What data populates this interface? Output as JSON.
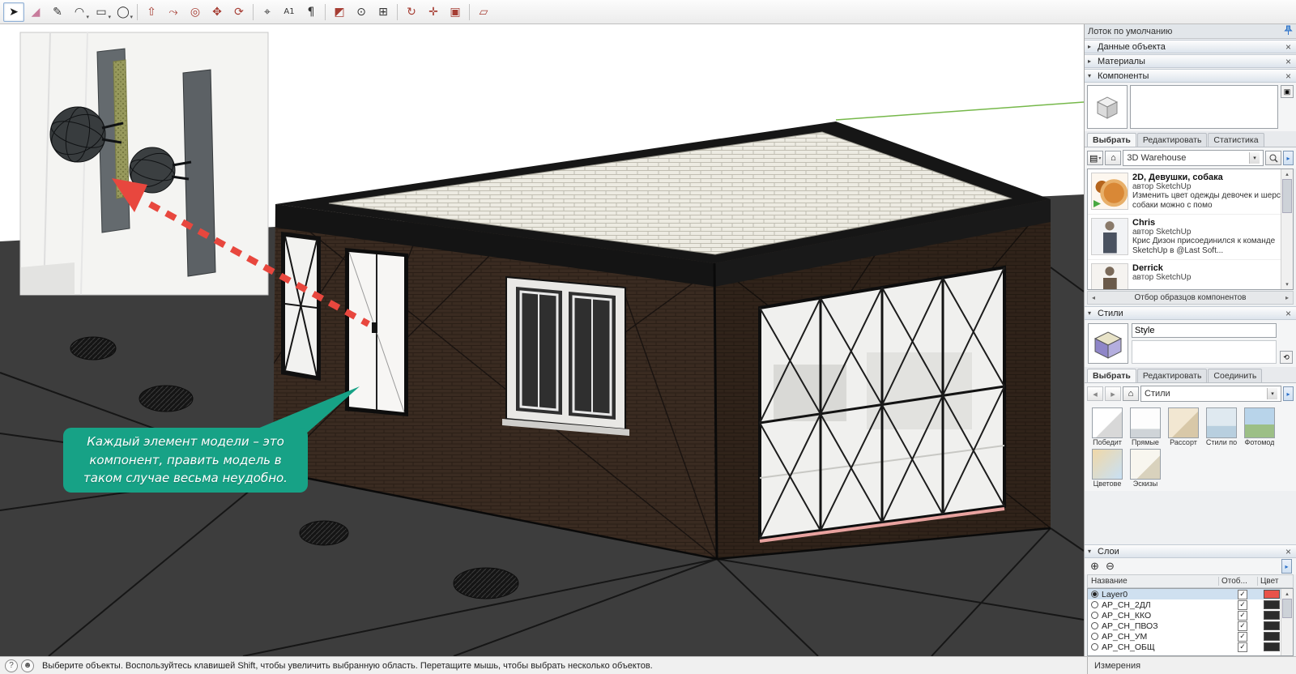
{
  "window": {
    "tray_title": "Лоток по умолчанию"
  },
  "colors": {
    "bubble_teal": "#17a286",
    "arrow_red": "#e8473e",
    "layer0_swatch": "#e8534a",
    "dark_layer_swatch": "#2b2b2b",
    "accent_blue": "#2a6fc9",
    "axis_green": "#76b84a"
  },
  "toolbar": {
    "tools": [
      {
        "name": "select",
        "glyph": "➤",
        "color": "#1a1a1a",
        "active": true
      },
      {
        "name": "eraser",
        "glyph": "◢",
        "color": "#c77b9b"
      },
      {
        "name": "line",
        "glyph": "✎",
        "color": "#333333"
      },
      {
        "name": "arc",
        "glyph": "◠",
        "color": "#333333",
        "dropdown": true
      },
      {
        "name": "rectangle",
        "glyph": "▭",
        "color": "#333333",
        "dropdown": true
      },
      {
        "name": "circle",
        "glyph": "◯",
        "color": "#333333",
        "dropdown": true
      },
      {
        "sep": true
      },
      {
        "name": "push-pull",
        "glyph": "⇧",
        "color": "#a63d33"
      },
      {
        "name": "follow-me",
        "glyph": "⤳",
        "color": "#a63d33"
      },
      {
        "name": "offset",
        "glyph": "◎",
        "color": "#a63d33"
      },
      {
        "name": "move",
        "glyph": "✥",
        "color": "#a63d33"
      },
      {
        "name": "rotate",
        "glyph": "⟳",
        "color": "#a63d33"
      },
      {
        "sep": true
      },
      {
        "name": "tape-measure",
        "glyph": "⌖",
        "color": "#333333"
      },
      {
        "name": "dimension",
        "glyph": "A1",
        "color": "#333333"
      },
      {
        "name": "text",
        "glyph": "¶",
        "color": "#333333"
      },
      {
        "sep": true
      },
      {
        "name": "paint-bucket",
        "glyph": "◩",
        "color": "#a63d33"
      },
      {
        "name": "zoom",
        "glyph": "⊙",
        "color": "#333333"
      },
      {
        "name": "zoom-window",
        "glyph": "⊞",
        "color": "#333333"
      },
      {
        "sep": true
      },
      {
        "name": "orbit",
        "glyph": "↻",
        "color": "#a63d33"
      },
      {
        "name": "pan",
        "glyph": "✛",
        "color": "#a63d33"
      },
      {
        "name": "camera",
        "glyph": "▣",
        "color": "#a63d33"
      },
      {
        "sep": true
      },
      {
        "name": "section-plane",
        "glyph": "▱",
        "color": "#a63d33"
      }
    ]
  },
  "viewport": {
    "bubble": {
      "line1": "Каждый элемент модели – это",
      "line2": "компонент, править модель в",
      "line3": "таком случае весьма неудобно."
    }
  },
  "sidebar": {
    "panels": {
      "entity_info": "Данные объекта",
      "materials": "Материалы",
      "components": "Компоненты",
      "styles": "Стили",
      "layers": "Слои"
    },
    "components": {
      "tabs": [
        "Выбрать",
        "Редактировать",
        "Статистика"
      ],
      "search_value": "3D Warehouse",
      "items": [
        {
          "name": "2D, Девушки, собака",
          "author": "автор SketchUp",
          "desc": "Изменить цвет одежды девочек и шерсти собаки можно с помо",
          "thumb": "dog"
        },
        {
          "name": "Chris",
          "author": "автор SketchUp",
          "desc": "Крис Дизон присоединился к команде SketchUp в @Last Soft...",
          "thumb": "person"
        },
        {
          "name": "Derrick",
          "author": "автор SketchUp",
          "desc": "",
          "thumb": "person2"
        }
      ],
      "footer": "Отбор образцов компонентов"
    },
    "styles": {
      "name_value": "Style",
      "tabs": [
        "Выбрать",
        "Редактировать",
        "Соединить"
      ],
      "collection": "Стили",
      "thumbs": [
        {
          "label": "Победит"
        },
        {
          "label": "Прямые"
        },
        {
          "label": "Рассорт"
        },
        {
          "label": "Стили по"
        },
        {
          "label": "Фотомод"
        },
        {
          "label": "Цветове"
        },
        {
          "label": "Эскизы"
        }
      ]
    },
    "layers": {
      "columns": [
        "Название",
        "Отоб...",
        "Цвет"
      ],
      "rows": [
        {
          "name": "Layer0",
          "selected": true,
          "color": "#e8534a"
        },
        {
          "name": "AP_CH_2ДЛ",
          "selected": false,
          "color": "#2b2b2b"
        },
        {
          "name": "AP_CH_ККО",
          "selected": false,
          "color": "#2b2b2b"
        },
        {
          "name": "AP_CH_ПВОЗ",
          "selected": false,
          "color": "#2b2b2b"
        },
        {
          "name": "AP_CH_УМ",
          "selected": false,
          "color": "#2b2b2b"
        },
        {
          "name": "AP_CH_ОБЩ",
          "selected": false,
          "color": "#2b2b2b"
        }
      ]
    }
  },
  "statusbar": {
    "message": "Выберите объекты. Воспользуйтесь клавишей Shift, чтобы увеличить выбранную область. Перетащите мышь, чтобы выбрать несколько объектов.",
    "measurements": "Измерения"
  }
}
